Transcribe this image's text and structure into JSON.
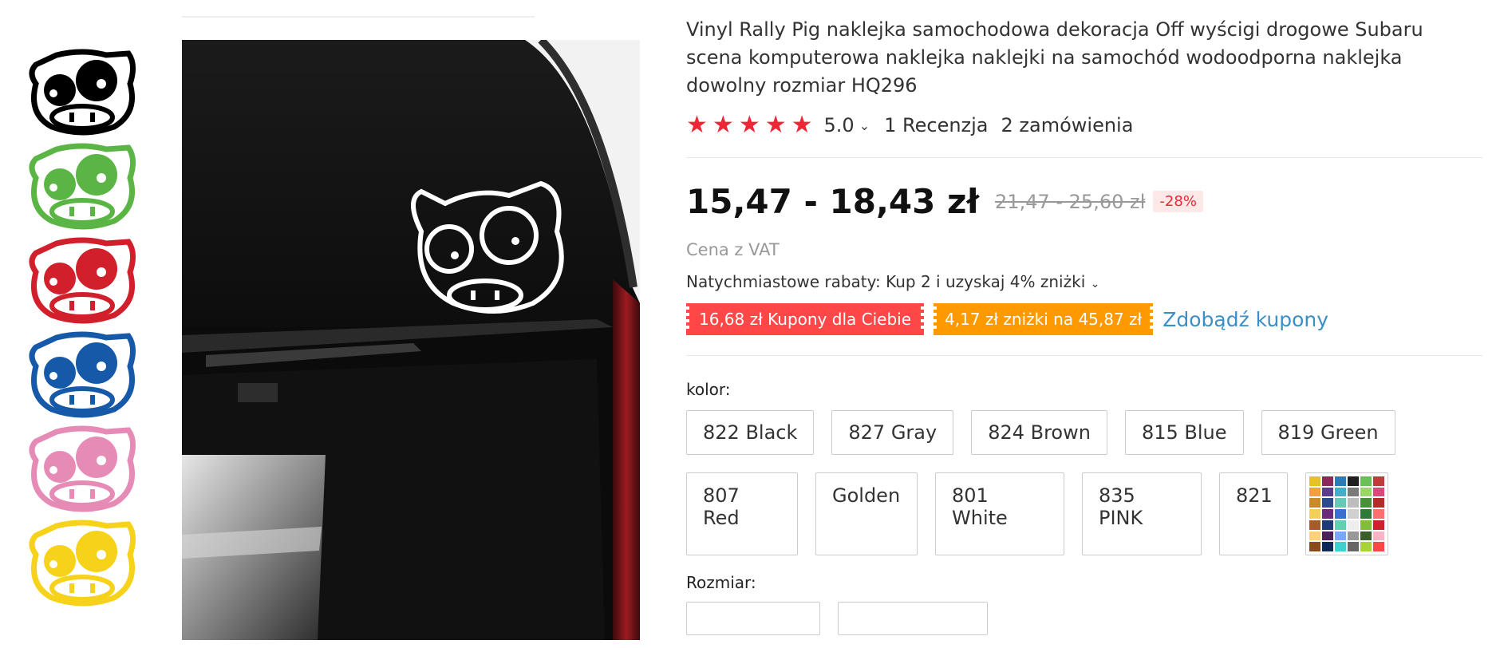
{
  "product": {
    "title": "Vinyl Rally Pig naklejka samochodowa dekoracja Off wyścigi drogowe Subaru scena komputerowa naklejka naklejki na samochód wodoodporna naklejka dowolny rozmiar HQ296",
    "rating": "5.0",
    "reviews": "1 Recenzja",
    "orders": "2 zamówienia"
  },
  "thumbnails": [
    {
      "color": "#000000",
      "name": "black"
    },
    {
      "color": "#5ab544",
      "name": "green"
    },
    {
      "color": "#d11f2b",
      "name": "red"
    },
    {
      "color": "#1659a8",
      "name": "blue"
    },
    {
      "color": "#e68bb6",
      "name": "pink"
    },
    {
      "color": "#f6d21a",
      "name": "yellow"
    }
  ],
  "price": {
    "range": "15,47 - 18,43 zł",
    "original": "21,47 - 25,60 zł",
    "discount": "-28%",
    "vat": "Cena z VAT",
    "rabat": "Natychmiastowe rabaty: Kup 2 i uzyskaj 4% zniżki"
  },
  "coupons": {
    "red": "16,68 zł Kupony dla Ciebie",
    "orange": "4,17 zł zniżki na 45,87 zł",
    "link": "Zdobądź kupony"
  },
  "color_section": {
    "label": "kolor:",
    "row1": [
      "822 Black",
      "827 Gray",
      "824 Brown",
      "815 Blue",
      "819 Green"
    ],
    "row2": [
      "807 Red",
      "Golden",
      "801 White",
      "835 PINK",
      "821"
    ]
  },
  "size_section": {
    "label": "Rozmiar:"
  },
  "colors": {
    "accent_red": "#ee2737",
    "coupon_red": "#ff4747",
    "coupon_orange": "#ff9900",
    "link_blue": "#3a8fc7"
  }
}
